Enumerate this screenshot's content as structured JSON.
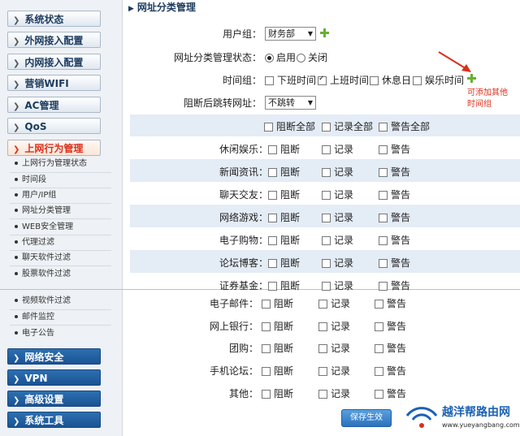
{
  "sidebar": {
    "top_items": [
      {
        "label": "系统状态"
      },
      {
        "label": "外网接入配置"
      },
      {
        "label": "内网接入配置"
      },
      {
        "label": "营销WIFI"
      },
      {
        "label": "AC管理"
      },
      {
        "label": "QoS"
      },
      {
        "label": "上网行为管理"
      }
    ],
    "sub_items": [
      {
        "label": "上网行为管理状态"
      },
      {
        "label": "时间段"
      },
      {
        "label": "用户/IP组"
      },
      {
        "label": "网址分类管理"
      },
      {
        "label": "WEB安全管理"
      },
      {
        "label": "代理过滤"
      },
      {
        "label": "聊天软件过滤"
      },
      {
        "label": "股票软件过滤"
      },
      {
        "label": "视频软件过滤"
      },
      {
        "label": "邮件监控"
      },
      {
        "label": "电子公告"
      }
    ],
    "bottom_items": [
      {
        "label": "网络安全"
      },
      {
        "label": "VPN"
      },
      {
        "label": "高级设置"
      },
      {
        "label": "系统工具"
      }
    ]
  },
  "page": {
    "title": "网址分类管理",
    "user_group_label": "用户组：",
    "user_group_value": "财务部",
    "status_label": "网址分类管理状态：",
    "status_on": "启用",
    "status_off": "关闭",
    "time_group_label": "时间组：",
    "time_options": [
      {
        "label": "下班时间",
        "checked": false
      },
      {
        "label": "上班时间",
        "checked": true
      },
      {
        "label": "休息日",
        "checked": false
      },
      {
        "label": "娱乐时间",
        "checked": false
      }
    ],
    "hint_line1": "可添加其他",
    "hint_line2": "时间组",
    "redirect_label": "阻断后跳转网址：",
    "redirect_value": "不跳转",
    "block_all": "阻断全部",
    "log_all": "记录全部",
    "warn_all": "警告全部",
    "col_block": "阻断",
    "col_log": "记录",
    "col_warn": "警告",
    "categories": [
      {
        "label": "休闲娱乐："
      },
      {
        "label": "新闻资讯："
      },
      {
        "label": "聊天交友："
      },
      {
        "label": "网络游戏："
      },
      {
        "label": "电子购物："
      },
      {
        "label": "论坛博客："
      },
      {
        "label": "证券基金："
      },
      {
        "label": "电子邮件："
      },
      {
        "label": "网上银行："
      },
      {
        "label": "团购："
      },
      {
        "label": "手机论坛："
      },
      {
        "label": "其他："
      }
    ],
    "save_label": "保存生效"
  },
  "watermark": {
    "title": "越洋帮路由网",
    "url": "www.yueyangbang.com"
  },
  "colors": {
    "accent_red": "#d9301b",
    "nav_blue": "#1b5394",
    "band_blue": "#e4ecf6",
    "plus_green": "#68b030"
  }
}
